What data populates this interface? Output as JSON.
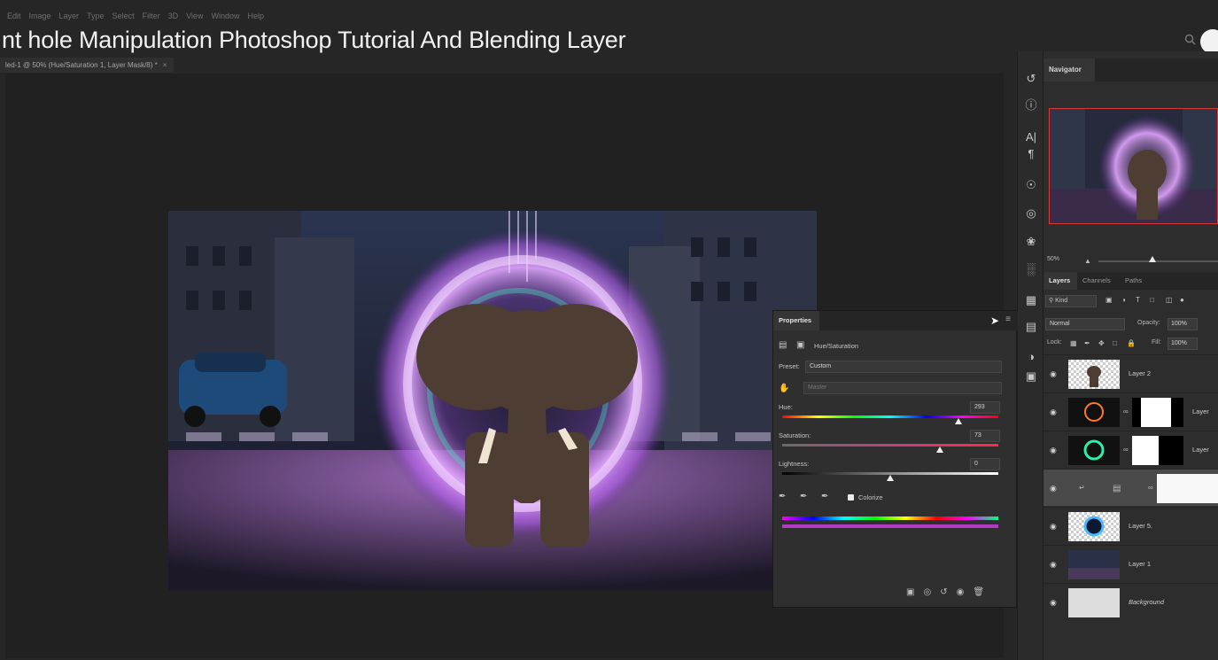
{
  "menu": [
    "Edit",
    "Image",
    "Layer",
    "Type",
    "Select",
    "Filter",
    "3D",
    "View",
    "Window",
    "Help"
  ],
  "video_title": "nt hole Manipulation Photoshop Tutorial And Blending Layer",
  "document_tab": {
    "label": "led-1 @ 50% (Hue/Saturation 1, Layer Mask/8) *",
    "close": "×"
  },
  "navigator": {
    "tab": "Navigator",
    "zoom": "50%"
  },
  "layers_panel": {
    "tabs": [
      "Layers",
      "Channels",
      "Paths"
    ],
    "filter": "Kind",
    "blend_mode": "Normal",
    "opacity_label": "Opacity:",
    "opacity": "100%",
    "lock_label": "Lock:",
    "fill_label": "Fill:",
    "fill": "100%",
    "layers": [
      {
        "name": "Layer 2",
        "selected": false
      },
      {
        "name": "Layer",
        "selected": false
      },
      {
        "name": "Layer",
        "selected": false
      },
      {
        "name": "",
        "selected": true
      },
      {
        "name": "Layer 5.",
        "selected": false
      },
      {
        "name": "Layer 1",
        "selected": false
      },
      {
        "name": "Background",
        "selected": false
      }
    ]
  },
  "properties": {
    "title": "Properties",
    "adjustment": "Hue/Saturation",
    "preset_label": "Preset:",
    "preset": "Custom",
    "channel": "Master",
    "hue_label": "Hue:",
    "hue": 293,
    "saturation_label": "Saturation:",
    "saturation": 73,
    "lightness_label": "Lightness:",
    "lightness": 0,
    "colorize_label": "Colorize",
    "colorize": true
  },
  "colors": {
    "panel_bg": "#2d2d2d",
    "canvas_bg": "#212121",
    "selection_border": "#d83b3b"
  }
}
